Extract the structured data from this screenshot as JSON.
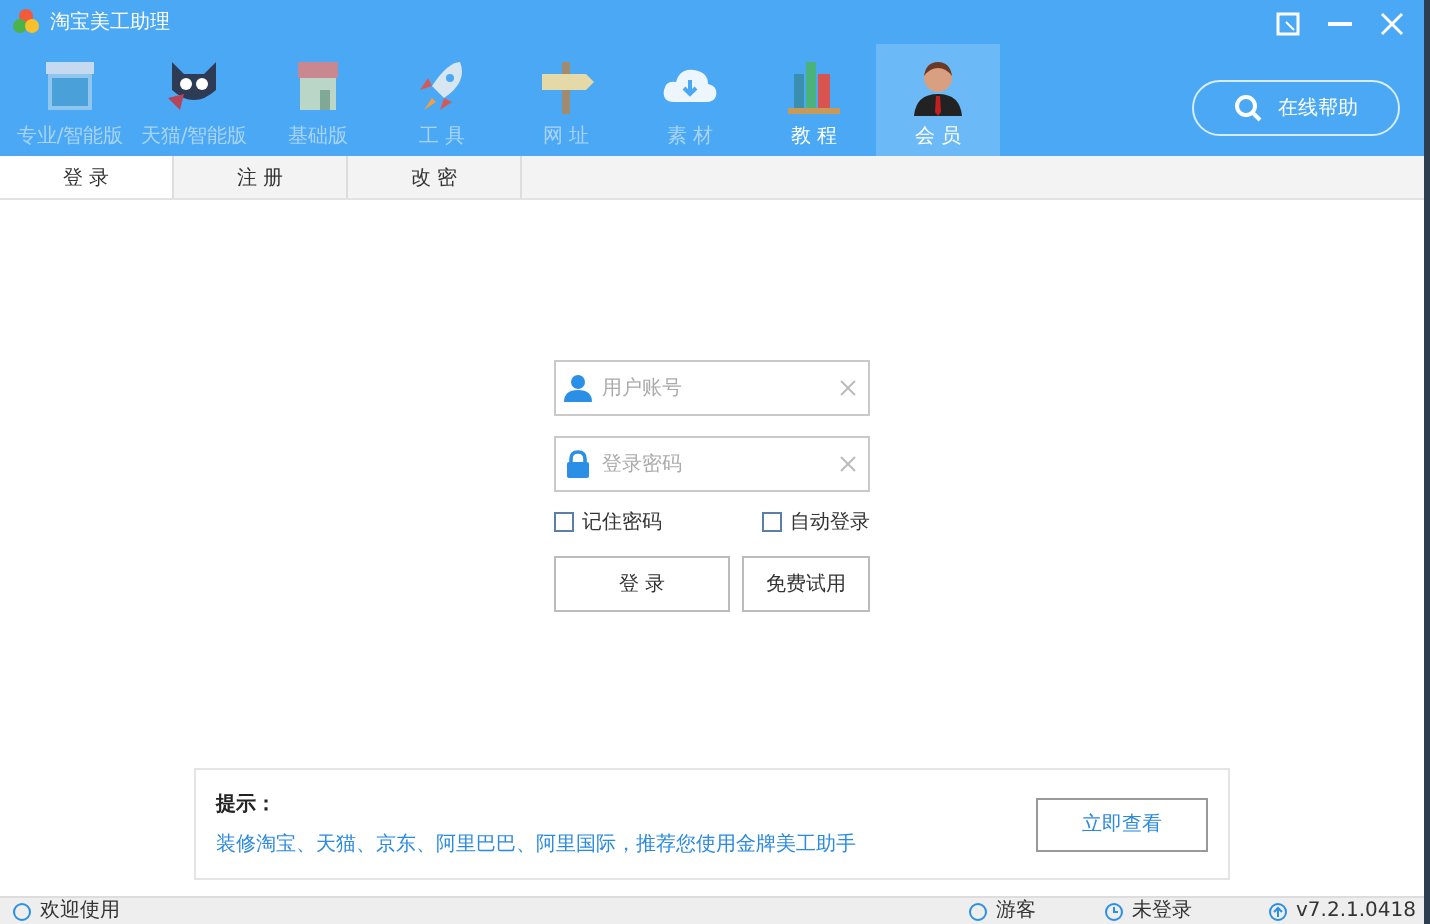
{
  "window": {
    "title": "淘宝美工助理"
  },
  "nav": [
    {
      "label": "专业/智能版",
      "kind": "store",
      "selected": false,
      "disabled": true
    },
    {
      "label": "天猫/智能版",
      "kind": "cat",
      "selected": false,
      "disabled": true
    },
    {
      "label": "基础版",
      "kind": "shop",
      "selected": false,
      "disabled": true
    },
    {
      "label": "工 具",
      "kind": "rocket",
      "selected": false,
      "disabled": true
    },
    {
      "label": "网 址",
      "kind": "sign",
      "selected": false,
      "disabled": true
    },
    {
      "label": "素 材",
      "kind": "cloud",
      "selected": false,
      "disabled": true
    },
    {
      "label": "教 程",
      "kind": "books",
      "selected": false,
      "disabled": false
    },
    {
      "label": "会 员",
      "kind": "person",
      "selected": true,
      "disabled": false
    }
  ],
  "help_button": "在线帮助",
  "tabs": [
    {
      "label": "登 录",
      "selected": true
    },
    {
      "label": "注 册",
      "selected": false
    },
    {
      "label": "改 密",
      "selected": false
    }
  ],
  "login": {
    "username": {
      "placeholder": "用户账号"
    },
    "password": {
      "placeholder": "登录密码"
    },
    "options": [
      {
        "label": "记住密码",
        "checked": false
      },
      {
        "label": "自动登录",
        "checked": false
      }
    ],
    "login_button": "登 录",
    "trial_button": "免费试用"
  },
  "notice": {
    "title": "提示：",
    "text": "装修淘宝、天猫、京东、阿里巴巴、阿里国际，推荐您使用金牌美工助手",
    "button": "立即查看"
  },
  "status_bar": {
    "welcome": "欢迎使用",
    "user": "游客",
    "login_state": "未登录",
    "version": "v7.2.1.0418"
  }
}
